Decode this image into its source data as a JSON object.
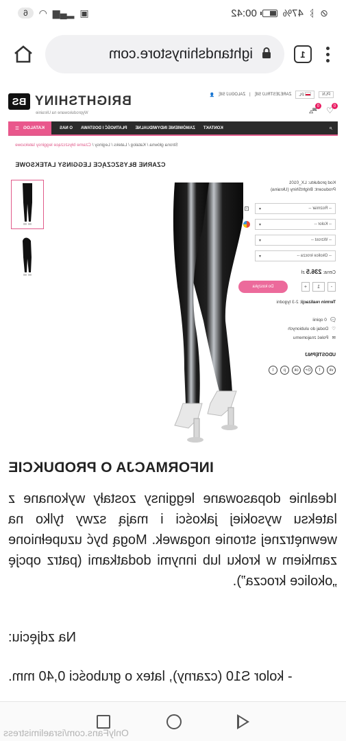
{
  "status_bar": {
    "time": "00:42",
    "battery_percent": "47%",
    "battery_level": 0.47,
    "notification_count": "6"
  },
  "browser": {
    "url": "ightandshinystore.com",
    "tab_count": "1",
    "icons": [
      "home-icon",
      "lock-icon",
      "tabs-icon",
      "menu-icon"
    ]
  },
  "shop": {
    "logo_mark": "BS",
    "logo_text": "BRIGHTSHINY",
    "logo_sub": "Wyprodukowane na Ukrainie",
    "login": "ZALOGUJ SIĘ",
    "register": "ZAREJESTRUJ SIĘ",
    "lang": "PL",
    "currency": "PLN",
    "cart_count": "0",
    "wishlist_count": "0"
  },
  "nav": {
    "katalog": "KATALOG",
    "items": [
      "O NAS",
      "PŁATNOŚĆ I DOSTAWA",
      "ZAMÓWIENIE INDYWIDUALNE",
      "KONTAKT"
    ]
  },
  "breadcrumb": {
    "items": [
      "Strona główna",
      "Katalog",
      "Lateks",
      "Leginsy"
    ],
    "current": "Czarne błyszczące legginsy lateksowe"
  },
  "product": {
    "title": "CZARNE BŁYSZCZĄCE LEGGINSY LATEKSOWE",
    "code": "Kod produktu: LX_0101",
    "producer": "Producent: BrightShiny (Ukraina)",
    "options": [
      {
        "label": "-- Rozmiar --",
        "icon": "size-icon"
      },
      {
        "label": "-- Kolor --",
        "icon": "color-icon"
      },
      {
        "label": "-- Wzrost --",
        "icon": ""
      },
      {
        "label": "-- Okolice krocza --",
        "icon": ""
      }
    ],
    "price_label": "Cena:",
    "price_value": "236.5",
    "price_currency": "zł",
    "qty_minus": "-",
    "qty_value": "1",
    "qty_plus": "+",
    "add_to_cart": "Do koszyka",
    "lead_label": "Termin realizacji:",
    "lead_value": "2-3 tygodni",
    "reviews": "0 opinii",
    "wishlist": "Dodaj do ulubionych",
    "recommend": "Poleć znajomemu",
    "share_title": "UDOSTĘPNIJ"
  },
  "info": {
    "title": "INFORMACJA O PRODUKCIE",
    "text": "Idealnie dopasowane legginsy zostały wykonane z lateksu wysokiej jakości i mają szwy tylko na wewnętrznej stronie nogawek. Mogą być uzupełnione zamkiem w kroku lub innymi dodatkami (patrz opcję „okolice krocza”).",
    "caption_label": "Na zdjęciu:",
    "caption_line": "- kolor S10 (czarny), latex o grubości 0,40 mm."
  },
  "watermark": "OnlyFans.com/israelimistress",
  "colors": {
    "accent": "#e9578c",
    "nav_bg": "#2b2b2b"
  }
}
